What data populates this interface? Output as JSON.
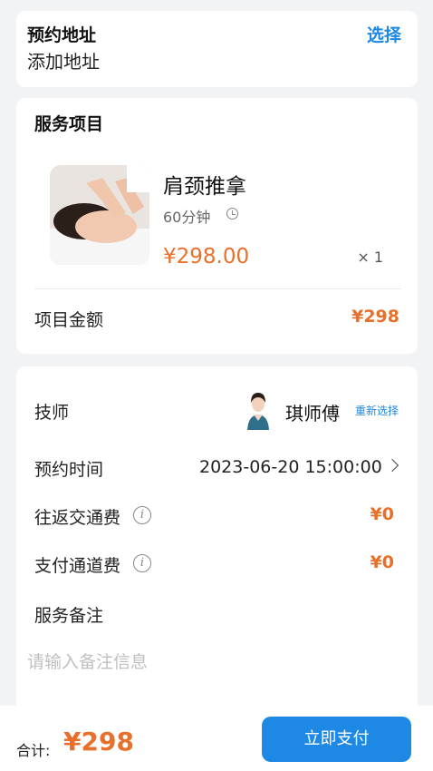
{
  "address": {
    "title": "预约地址",
    "value": "添加地址",
    "select_label": "选择"
  },
  "service": {
    "section_title": "服务项目",
    "item": {
      "name": "肩颈推拿",
      "duration": "60分钟",
      "price": "¥298.00",
      "quantity": "× 1"
    },
    "amount_label": "项目金额",
    "amount_value": "¥298"
  },
  "details": {
    "technician_label": "技师",
    "technician_name": "琪师傅",
    "reselect_label": "重新选择",
    "time_label": "预约时间",
    "time_value": "2023-06-20 15:00:00",
    "travel_fee_label": "往返交通费",
    "travel_fee_value": "¥0",
    "channel_fee_label": "支付通道费",
    "channel_fee_value": "¥0",
    "remark_label": "服务备注",
    "remark_placeholder": "请输入备注信息",
    "info_icon_glyph": "i"
  },
  "footer": {
    "total_label": "合计:",
    "total_value": "¥298",
    "pay_label": "立即支付"
  },
  "colors": {
    "accent": "#1e88e5",
    "price": "#e8702a",
    "background": "#f2f3f5"
  },
  "icons": {
    "clock": "clock-icon",
    "info": "info-icon",
    "chevron": "chevron-right-icon"
  }
}
